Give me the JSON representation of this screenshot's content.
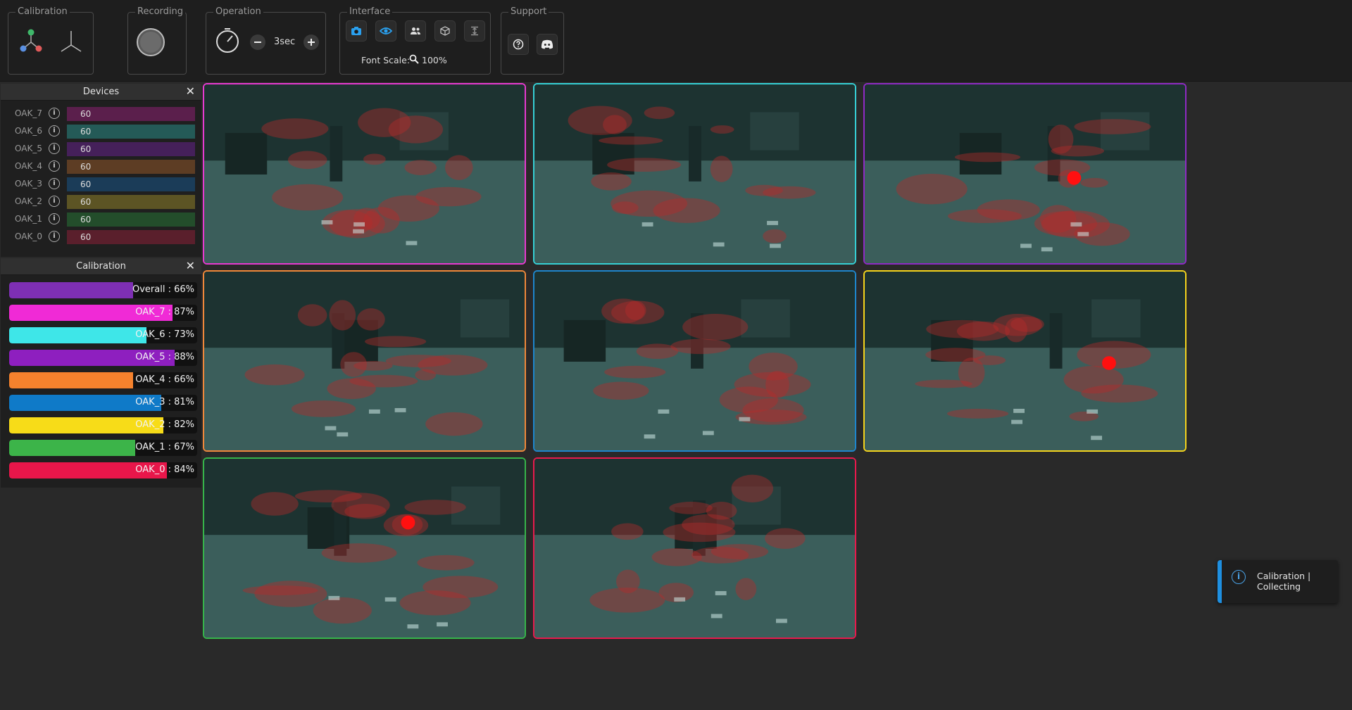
{
  "toolbar": {
    "calibration_label": "Calibration",
    "recording_label": "Recording",
    "operation_label": "Operation",
    "operation_value": "3sec",
    "interface_label": "Interface",
    "font_scale_label": "Font Scale:",
    "font_scale_value": "100%",
    "support_label": "Support"
  },
  "devices_panel": {
    "title": "Devices",
    "items": [
      {
        "name": "OAK_7",
        "value": "60",
        "color": "#5b1f4c"
      },
      {
        "name": "OAK_6",
        "value": "60",
        "color": "#245a57"
      },
      {
        "name": "OAK_5",
        "value": "60",
        "color": "#45205a"
      },
      {
        "name": "OAK_4",
        "value": "60",
        "color": "#5d3d24"
      },
      {
        "name": "OAK_3",
        "value": "60",
        "color": "#1b3c58"
      },
      {
        "name": "OAK_2",
        "value": "60",
        "color": "#5c5424"
      },
      {
        "name": "OAK_1",
        "value": "60",
        "color": "#234d2b"
      },
      {
        "name": "OAK_0",
        "value": "60",
        "color": "#5a1f2c"
      }
    ]
  },
  "calibration_panel": {
    "title": "Calibration",
    "items": [
      {
        "label": "Overall : 66%",
        "percent": 0.66,
        "color": "#7e2fb4"
      },
      {
        "label": "OAK_7 : 87%",
        "percent": 0.87,
        "color": "#f02ad6"
      },
      {
        "label": "OAK_6 : 73%",
        "percent": 0.73,
        "color": "#3ee6e8"
      },
      {
        "label": "OAK_5 : 88%",
        "percent": 0.88,
        "color": "#8e1fbf"
      },
      {
        "label": "OAK_4 : 66%",
        "percent": 0.66,
        "color": "#f5822d"
      },
      {
        "label": "OAK_3 : 81%",
        "percent": 0.81,
        "color": "#0f7ac8"
      },
      {
        "label": "OAK_2 : 82%",
        "percent": 0.82,
        "color": "#f7dc18"
      },
      {
        "label": "OAK_1 : 67%",
        "percent": 0.67,
        "color": "#3cb449"
      },
      {
        "label": "OAK_0 : 84%",
        "percent": 0.84,
        "color": "#e8164a"
      }
    ]
  },
  "camera_feeds": [
    {
      "border_color": "#e73ad0"
    },
    {
      "border_color": "#36cfd4"
    },
    {
      "border_color": "#8e2bc4"
    },
    {
      "border_color": "#f0883a"
    },
    {
      "border_color": "#1e86cc"
    },
    {
      "border_color": "#f5d41c"
    },
    {
      "border_color": "#36b44a"
    },
    {
      "border_color": "#e81a4d"
    }
  ],
  "toast": {
    "text": "Calibration | Collecting",
    "accent_color": "#1e8fe0"
  },
  "icons": [
    "axes-color-icon",
    "axes-icon",
    "record-icon",
    "timer-icon",
    "minus-icon",
    "plus-icon",
    "camera-icon",
    "eye-icon",
    "people-icon",
    "cube-icon",
    "split-icon",
    "search-icon",
    "help-icon",
    "discord-icon",
    "info-icon",
    "close-icon"
  ]
}
